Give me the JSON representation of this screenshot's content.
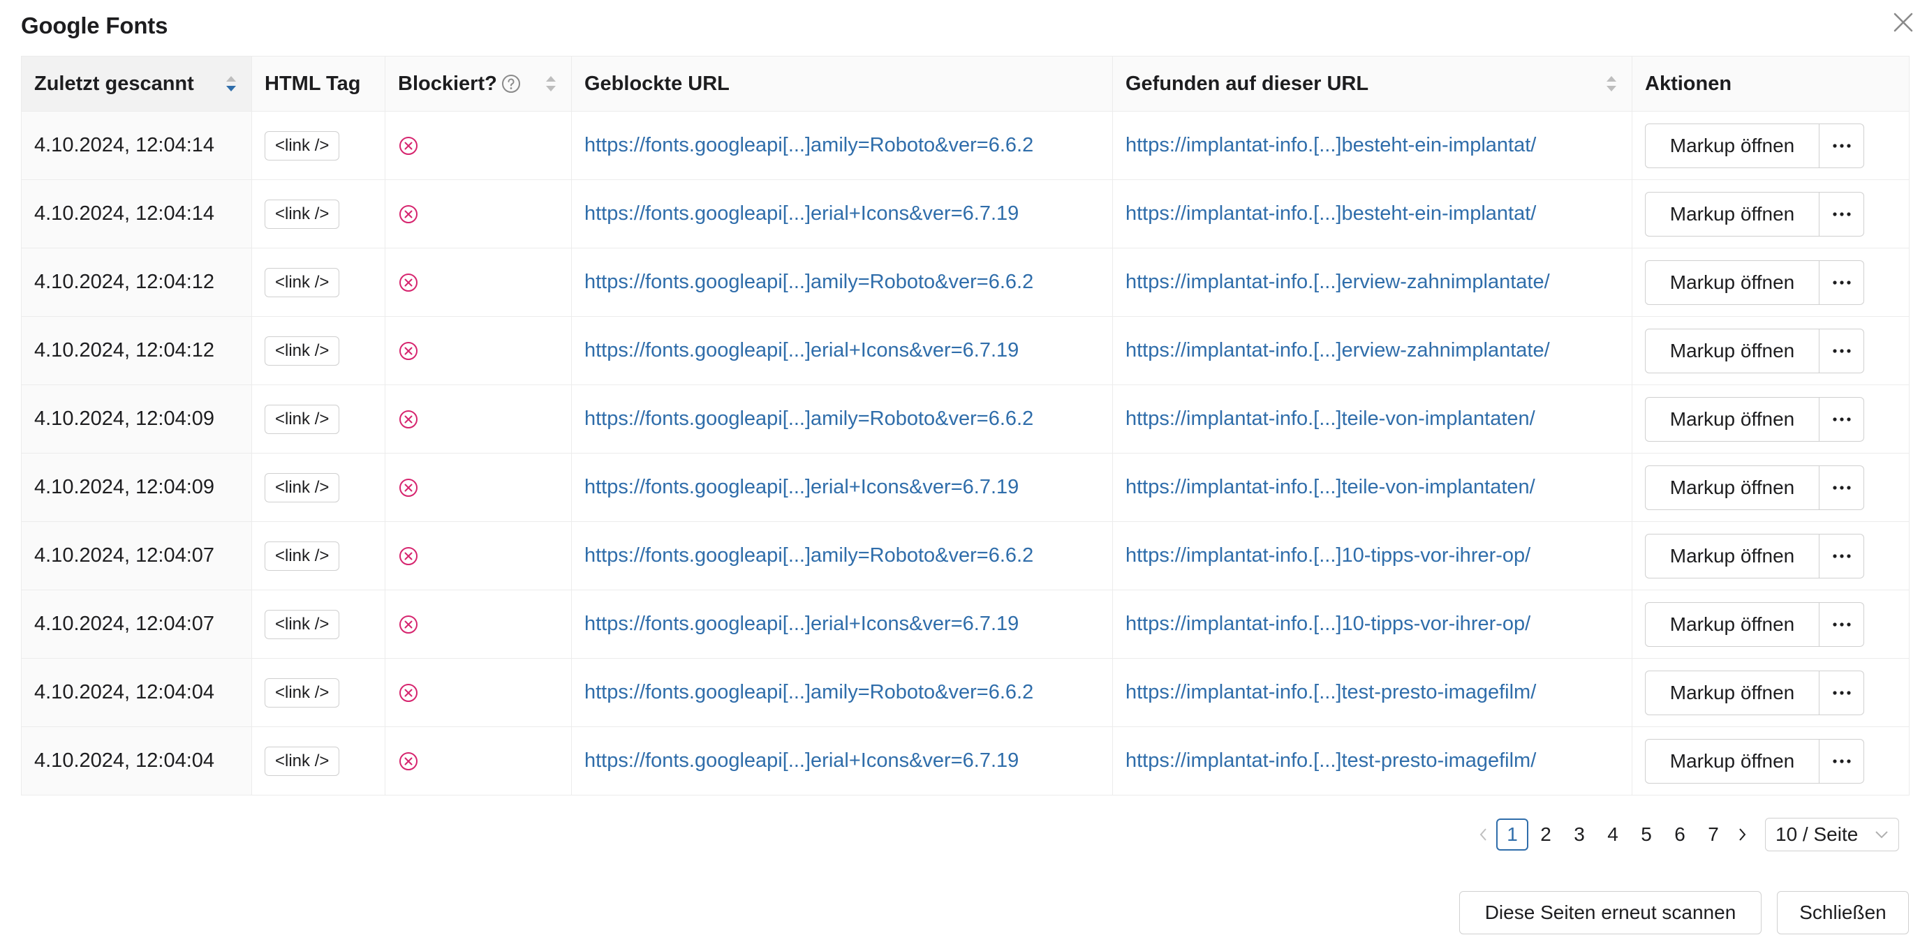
{
  "modal": {
    "title": "Google Fonts",
    "close_icon": "close-icon"
  },
  "table": {
    "columns": [
      {
        "key": "scanned",
        "label": "Zuletzt gescannt",
        "sortable": true,
        "sorted": "desc"
      },
      {
        "key": "tag",
        "label": "HTML Tag",
        "sortable": false
      },
      {
        "key": "blocked",
        "label": "Blockiert?",
        "sortable": true,
        "help_icon": "question-circle-icon"
      },
      {
        "key": "blocked_url",
        "label": "Geblockte URL",
        "sortable": false
      },
      {
        "key": "found_url",
        "label": "Gefunden auf dieser URL",
        "sortable": true
      },
      {
        "key": "actions",
        "label": "Aktionen",
        "sortable": false
      }
    ],
    "rows": [
      {
        "scanned": "4.10.2024, 12:04:14",
        "tag": "<link />",
        "blocked": "blocked-x-icon",
        "blocked_url": "https://fonts.googleapi[...]amily=Roboto&ver=6.6.2",
        "found_url": "https://implantat-info.[...]besteht-ein-implantat/",
        "action": "Markup öffnen"
      },
      {
        "scanned": "4.10.2024, 12:04:14",
        "tag": "<link />",
        "blocked": "blocked-x-icon",
        "blocked_url": "https://fonts.googleapi[...]erial+Icons&ver=6.7.19",
        "found_url": "https://implantat-info.[...]besteht-ein-implantat/",
        "action": "Markup öffnen"
      },
      {
        "scanned": "4.10.2024, 12:04:12",
        "tag": "<link />",
        "blocked": "blocked-x-icon",
        "blocked_url": "https://fonts.googleapi[...]amily=Roboto&ver=6.6.2",
        "found_url": "https://implantat-info.[...]erview-zahnimplantate/",
        "action": "Markup öffnen"
      },
      {
        "scanned": "4.10.2024, 12:04:12",
        "tag": "<link />",
        "blocked": "blocked-x-icon",
        "blocked_url": "https://fonts.googleapi[...]erial+Icons&ver=6.7.19",
        "found_url": "https://implantat-info.[...]erview-zahnimplantate/",
        "action": "Markup öffnen"
      },
      {
        "scanned": "4.10.2024, 12:04:09",
        "tag": "<link />",
        "blocked": "blocked-x-icon",
        "blocked_url": "https://fonts.googleapi[...]amily=Roboto&ver=6.6.2",
        "found_url": "https://implantat-info.[...]teile-von-implantaten/",
        "action": "Markup öffnen"
      },
      {
        "scanned": "4.10.2024, 12:04:09",
        "tag": "<link />",
        "blocked": "blocked-x-icon",
        "blocked_url": "https://fonts.googleapi[...]erial+Icons&ver=6.7.19",
        "found_url": "https://implantat-info.[...]teile-von-implantaten/",
        "action": "Markup öffnen"
      },
      {
        "scanned": "4.10.2024, 12:04:07",
        "tag": "<link />",
        "blocked": "blocked-x-icon",
        "blocked_url": "https://fonts.googleapi[...]amily=Roboto&ver=6.6.2",
        "found_url": "https://implantat-info.[...]10-tipps-vor-ihrer-op/",
        "action": "Markup öffnen"
      },
      {
        "scanned": "4.10.2024, 12:04:07",
        "tag": "<link />",
        "blocked": "blocked-x-icon",
        "blocked_url": "https://fonts.googleapi[...]erial+Icons&ver=6.7.19",
        "found_url": "https://implantat-info.[...]10-tipps-vor-ihrer-op/",
        "action": "Markup öffnen"
      },
      {
        "scanned": "4.10.2024, 12:04:04",
        "tag": "<link />",
        "blocked": "blocked-x-icon",
        "blocked_url": "https://fonts.googleapi[...]amily=Roboto&ver=6.6.2",
        "found_url": "https://implantat-info.[...]test-presto-imagefilm/",
        "action": "Markup öffnen"
      },
      {
        "scanned": "4.10.2024, 12:04:04",
        "tag": "<link />",
        "blocked": "blocked-x-icon",
        "blocked_url": "https://fonts.googleapi[...]erial+Icons&ver=6.7.19",
        "found_url": "https://implantat-info.[...]test-presto-imagefilm/",
        "action": "Markup öffnen"
      }
    ],
    "more_icon": "ellipsis-icon"
  },
  "pagination": {
    "prev_icon": "chevron-left-icon",
    "next_icon": "chevron-right-icon",
    "pages": [
      "1",
      "2",
      "3",
      "4",
      "5",
      "6",
      "7"
    ],
    "current": "1",
    "page_size": "10 / Seite",
    "page_size_icon": "chevron-down-icon"
  },
  "footer": {
    "rescan_label": "Diese Seiten erneut scannen",
    "close_label": "Schließen"
  },
  "colors": {
    "link": "#2f6daa",
    "blocked": "#d6246e",
    "active_page": "#2f6daa",
    "header_bg": "#fafafa"
  }
}
